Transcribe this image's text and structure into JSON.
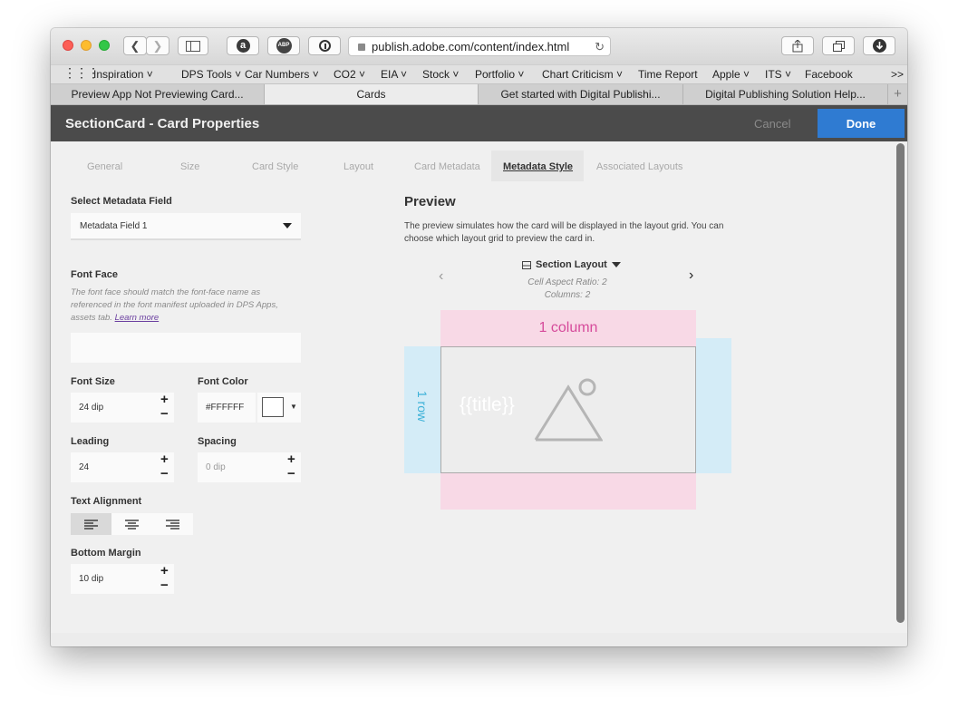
{
  "browser": {
    "url": "publish.adobe.com/content/index.html",
    "bookmarks": [
      "Inspiration",
      "DPS Tools",
      "Car Numbers",
      "CO2",
      "EIA",
      "Stock",
      "Portfolio",
      "Chart Criticism",
      "Time Report",
      "Apple",
      "ITS",
      "Facebook"
    ],
    "bookmarks_overflow": ">>",
    "tabs": [
      "Preview App Not Previewing Card...",
      "Cards",
      "Get started with Digital Publishi...",
      "Digital Publishing Solution Help..."
    ],
    "new_tab": "+"
  },
  "app": {
    "title": "SectionCard - Card Properties",
    "cancel_label": "Cancel",
    "done_label": "Done"
  },
  "property_tabs": [
    "General",
    "Size",
    "Card Style",
    "Layout",
    "Card Metadata",
    "Metadata Style",
    "Associated Layouts"
  ],
  "form": {
    "metadata_field_label": "Select Metadata Field",
    "metadata_field_value": "Metadata Field 1",
    "font_face_label": "Font Face",
    "font_face_help": "The font face should match the font-face name as referenced in the font manifest uploaded in DPS Apps, assets tab.",
    "learn_more": "Learn more",
    "font_face_value": "",
    "font_size_label": "Font Size",
    "font_size_value": "24 dip",
    "font_color_label": "Font Color",
    "font_color_value": "#FFFFFF",
    "leading_label": "Leading",
    "leading_value": "24",
    "spacing_label": "Spacing",
    "spacing_placeholder": "0 dip",
    "text_alignment_label": "Text Alignment",
    "bottom_margin_label": "Bottom Margin",
    "bottom_margin_value": "10 dip",
    "plus": "+",
    "minus": "−"
  },
  "preview": {
    "title": "Preview",
    "description": "The preview simulates how the card will be displayed in the layout grid. You can choose which layout grid to preview the card in.",
    "layout_name": "Section Layout",
    "cell_aspect_ratio": "Cell Aspect Ratio: 2",
    "columns": "Columns: 2",
    "column_label": "1 column",
    "row_label": "1 row",
    "card_text": "{{title}}",
    "prev_arrow": "‹",
    "next_arrow": "›"
  },
  "colors": {
    "accent": "#2f7bd2",
    "column_highlight": "#f8d9e6",
    "row_highlight": "#d4ecf7",
    "column_text": "#d64b9b",
    "row_text": "#3fb2d8"
  }
}
